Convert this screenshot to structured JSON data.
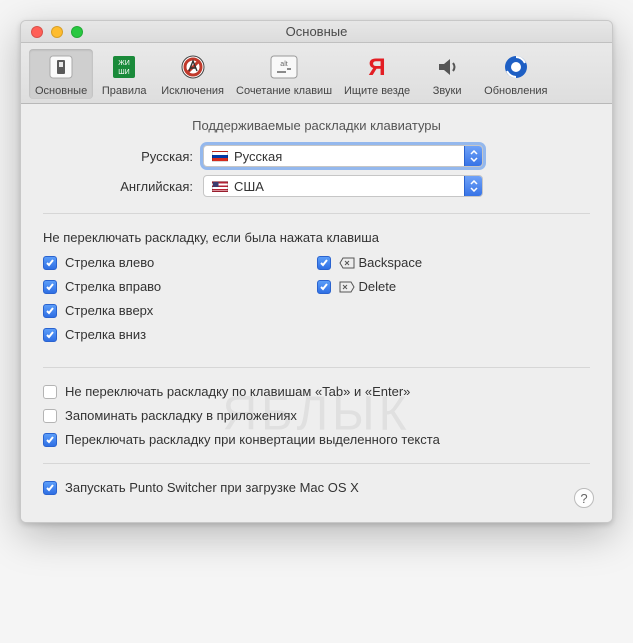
{
  "window": {
    "title": "Основные"
  },
  "toolbar": {
    "items": [
      {
        "label": "Основные",
        "icon": "switch-icon"
      },
      {
        "label": "Правила",
        "icon": "book-icon"
      },
      {
        "label": "Исключения",
        "icon": "nosign-icon"
      },
      {
        "label": "Сочетание клавиш",
        "icon": "alt-key-icon"
      },
      {
        "label": "Ищите везде",
        "icon": "yandex-icon"
      },
      {
        "label": "Звуки",
        "icon": "speaker-icon"
      },
      {
        "label": "Обновления",
        "icon": "update-icon"
      }
    ]
  },
  "layouts": {
    "heading": "Поддерживаемые раскладки клавиатуры",
    "russian_label": "Русская:",
    "russian_value": "Русская",
    "english_label": "Английская:",
    "english_value": "США"
  },
  "noswitch": {
    "heading": "Не переключать раскладку, если была нажата клавиша",
    "left": "Стрелка влево",
    "right": "Стрелка вправо",
    "up": "Стрелка вверх",
    "down": "Стрелка вниз",
    "backspace": "Backspace",
    "delete": "Delete"
  },
  "options": {
    "tab_enter": "Не переключать раскладку по клавишам «Tab» и «Enter»",
    "remember": "Запоминать раскладку в приложениях",
    "convert": "Переключать раскладку при конвертации выделенного текста",
    "autostart": "Запускать Punto Switcher при загрузке Mac OS X"
  },
  "watermark": "ЯБЛЫК"
}
